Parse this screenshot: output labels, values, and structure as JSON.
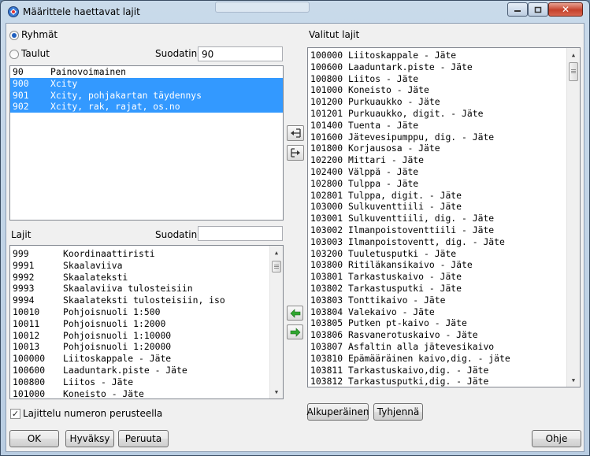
{
  "window": {
    "title": "Määrittele haettavat lajit"
  },
  "groups": {
    "radio_ryhmat": "Ryhmät",
    "radio_taulut": "Taulut",
    "filter_label": "Suodatin",
    "filter_value": "90",
    "items": [
      {
        "code": "90",
        "name": "Painovoimainen",
        "selected": false
      },
      {
        "code": "900",
        "name": "Xcity",
        "selected": true
      },
      {
        "code": "901",
        "name": "Xcity, pohjakartan täydennys",
        "selected": true
      },
      {
        "code": "902",
        "name": "Xcity, rak, rajat, os.no",
        "selected": true
      }
    ]
  },
  "types": {
    "label": "Lajit",
    "filter_label": "Suodatin",
    "filter_value": "",
    "items": [
      {
        "code": "999",
        "name": "Koordinaattiristi"
      },
      {
        "code": "9991",
        "name": "Skaalaviiva"
      },
      {
        "code": "9992",
        "name": "Skaalateksti"
      },
      {
        "code": "9993",
        "name": "Skaalaviiva tulosteisiin"
      },
      {
        "code": "9994",
        "name": "Skaalateksti tulosteisiin, iso"
      },
      {
        "code": "10010",
        "name": "Pohjoisnuoli 1:500"
      },
      {
        "code": "10011",
        "name": "Pohjoisnuoli 1:2000"
      },
      {
        "code": "10012",
        "name": "Pohjoisnuoli 1:10000"
      },
      {
        "code": "10013",
        "name": "Pohjoisnuoli 1:20000"
      },
      {
        "code": "100000",
        "name": "Liitoskappale - Jäte"
      },
      {
        "code": "100600",
        "name": "Laaduntark.piste - Jäte"
      },
      {
        "code": "100800",
        "name": "Liitos - Jäte"
      },
      {
        "code": "101000",
        "name": "Koneisto - Jäte"
      }
    ],
    "sort_checkbox": "Lajittelu numeron perusteella"
  },
  "selected": {
    "label": "Valitut lajit",
    "items": [
      "100000 Liitoskappale - Jäte",
      "100600 Laaduntark.piste - Jäte",
      "100800 Liitos - Jäte",
      "101000 Koneisto - Jäte",
      "101200 Purkuaukko - Jäte",
      "101201 Purkuaukko, digit. - Jäte",
      "101400 Tuenta - Jäte",
      "101600 Jätevesipumppu, dig. - Jäte",
      "101800 Korjausosa - Jäte",
      "102200 Mittari - Jäte",
      "102400 Välppä - Jäte",
      "102800 Tulppa - Jäte",
      "102801 Tulppa, digit. - Jäte",
      "103000 Sulkuventtiili - Jäte",
      "103001 Sulkuventtiili, dig. - Jäte",
      "103002 Ilmanpoistoventtiili - Jäte",
      "103003 Ilmanpoistoventt, dig. - Jäte",
      "103200 Tuuletusputki - Jäte",
      "103800 Ritiläkansikaivo - Jäte",
      "103801 Tarkastuskaivo - Jäte",
      "103802 Tarkastusputki - Jäte",
      "103803 Tonttikaivo - Jäte",
      "103804 Valekaivo - Jäte",
      "103805 Putken pt-kaivo - Jäte",
      "103806 Rasvanerotuskaivo - Jäte",
      "103807 Asfaltin alla jätevesikaivo",
      "103810 Epämääräinen kaivo,dig. - jäte",
      "103811 Tarkastuskaivo,dig. - Jäte",
      "103812 Tarkastusputki,dig. - Jäte"
    ],
    "btn_original": "Alkuperäinen",
    "btn_clear": "Tyhjennä"
  },
  "footer": {
    "ok": "OK",
    "apply": "Hyväksy",
    "cancel": "Peruuta",
    "help": "Ohje"
  },
  "colors": {
    "selection": "#3399ff",
    "arrow_green": "#2fa52f"
  }
}
